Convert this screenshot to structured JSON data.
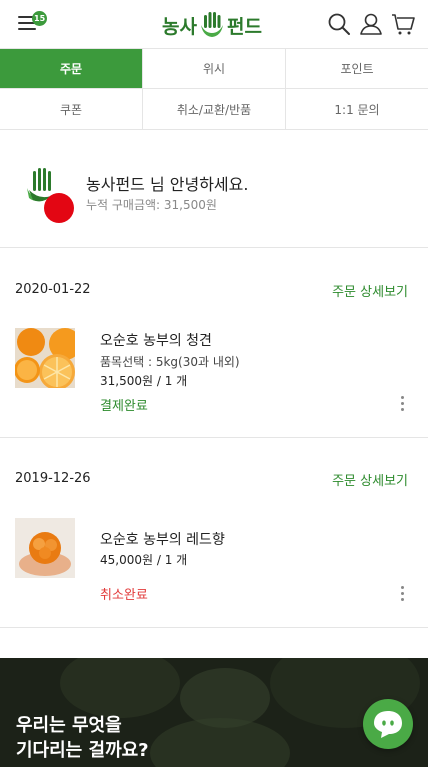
{
  "header": {
    "cart_count": "15",
    "logo_left": "농사",
    "logo_right": "펀드"
  },
  "tabs": [
    {
      "label": "주문",
      "active": true
    },
    {
      "label": "위시",
      "active": false
    },
    {
      "label": "포인트",
      "active": false
    },
    {
      "label": "쿠폰",
      "active": false
    },
    {
      "label": "취소/교환/반품",
      "active": false
    },
    {
      "label": "1:1 문의",
      "active": false
    }
  ],
  "profile": {
    "greeting": "농사펀드 님 안녕하세요.",
    "total_purchase": "누적 구매금액: 31,500원"
  },
  "orders": [
    {
      "date": "2020-01-22",
      "detail_link": "주문 상세보기",
      "product_name": "오순호 농부의 청견",
      "option": "품목선택 : 5kg(30과 내외)",
      "price_qty": "31,500원 / 1 개",
      "status": "결제완료"
    },
    {
      "date": "2019-12-26",
      "detail_link": "주문 상세보기",
      "product_name": "오순호 농부의 레드향",
      "price_qty": "45,000원 / 1 개",
      "status": "취소완료"
    }
  ],
  "banner": {
    "line1": "우리는 무엇을",
    "line2": "기다리는 걸까요?"
  },
  "colors": {
    "brand_green": "#3c9a3c",
    "status_green": "#2c8a2c",
    "status_red": "#e23a3a"
  },
  "icons": [
    "menu-icon",
    "search-icon",
    "user-icon",
    "cart-icon",
    "more-icon",
    "chat-icon"
  ]
}
